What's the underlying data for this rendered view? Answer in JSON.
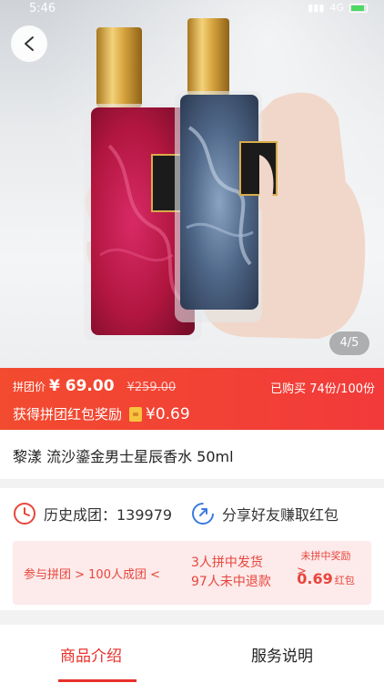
{
  "status": {
    "time": "5:46",
    "network": "4G"
  },
  "gallery": {
    "counter": "4/5"
  },
  "price": {
    "label": "拼团价",
    "value": "¥ 69.00",
    "original": "¥259.00",
    "sold": "已购买 74份/100份",
    "reward_text": "获得拼团红包奖励",
    "reward_amount": "¥0.69"
  },
  "product": {
    "title": "黎漾  流沙鎏金男士星辰香水 50ml"
  },
  "stats": {
    "history": "历史成团：139979",
    "share": "分享好友赚取红包"
  },
  "flow": {
    "step1": "参与拼团 > 100人成团 <",
    "line1": "3人拼中发货",
    "line2": "97人未中退款",
    "arrow": ">",
    "reward_label": "未拼中奖励",
    "reward_amount": "0.69",
    "reward_unit": "红包"
  },
  "tabs": [
    {
      "label": "商品介绍",
      "active": true
    },
    {
      "label": "服务说明",
      "active": false
    }
  ],
  "colors": {
    "accent": "#e8302a",
    "price_bar": "#f2453a",
    "flow_bg": "#fdeaea"
  }
}
